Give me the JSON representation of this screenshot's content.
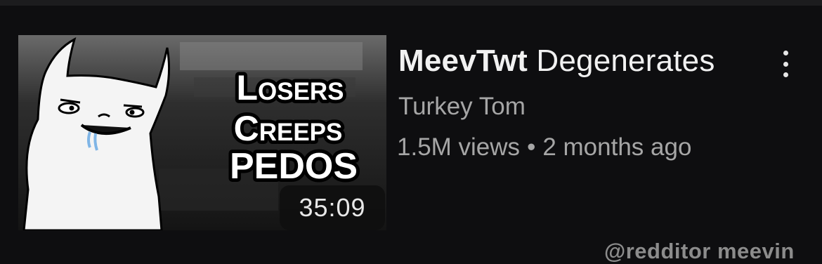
{
  "video": {
    "title_part1": "MeevTwt",
    "title_part2": "Degenerates",
    "channel": "Turkey Tom",
    "views": "1.5M views",
    "separator": "•",
    "age": "2 months ago",
    "duration": "35:09"
  },
  "thumbnail": {
    "lines": [
      "Losers",
      "Creeps",
      "PEDOS"
    ]
  },
  "menu": {
    "icon": "more-vertical-icon"
  },
  "watermark": "@redditor meevin",
  "colors": {
    "background": "#0e0e10",
    "title": "#f1f1f1",
    "secondary": "#a6a6a6",
    "badge": "#0f0f0f"
  }
}
